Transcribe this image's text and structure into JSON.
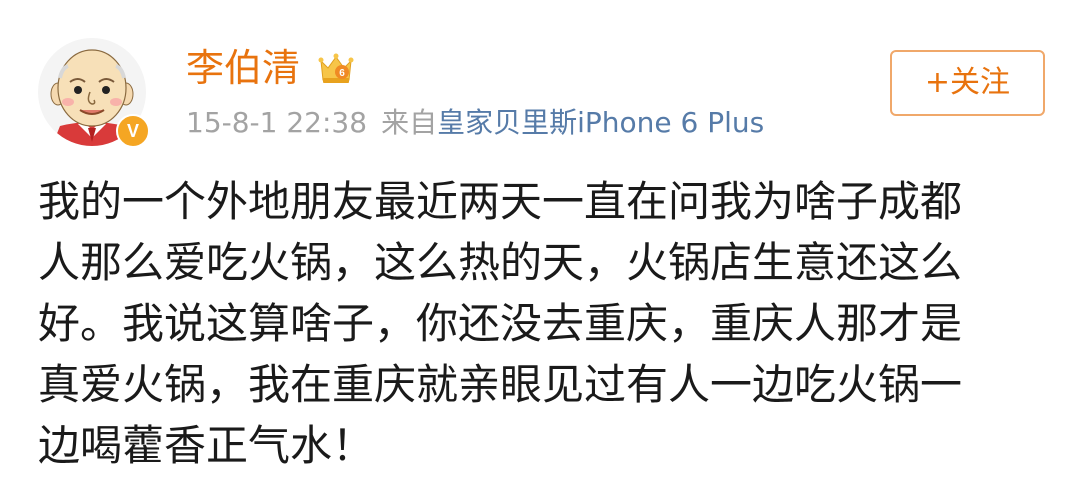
{
  "user": {
    "name": "李伯清",
    "verified_badge": "V",
    "avatar_icon": "cartoon-portrait-avatar",
    "member_icon": "crown-member-icon",
    "member_level": "6"
  },
  "meta": {
    "time": "15-8-1 22:38",
    "from_label": "来自",
    "source": "皇家贝里斯iPhone 6 Plus"
  },
  "follow_button": {
    "label": "+关注"
  },
  "post": {
    "lines": [
      "我的一个外地朋友最近两天一直在问我为啥子成都",
      "人那么爱吃火锅，这么热的天，火锅店生意还这么",
      "好。我说这算啥子，你还没去重庆，重庆人那才是",
      "真爱火锅，我在重庆就亲眼见过有人一边吃火锅一",
      "边喝藿香正气水！"
    ]
  },
  "colors": {
    "accent": "#e8730e",
    "link": "#567ba8",
    "meta": "#a3a3a3",
    "text": "#1a1a1a"
  }
}
